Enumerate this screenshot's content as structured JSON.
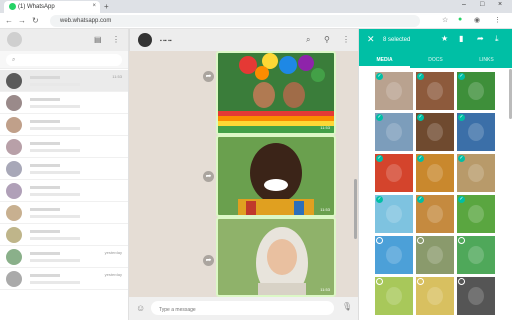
{
  "browser": {
    "tab_title": "(1) WhatsApp",
    "tab_close": "×",
    "new_tab": "+",
    "url": "web.whatsapp.com",
    "window_controls": [
      "–",
      "□",
      "×"
    ]
  },
  "left": {
    "chats": [
      {
        "time": "11:53",
        "avatar": "#5a5a5a"
      },
      {
        "time": "",
        "avatar": "#9a8a8a"
      },
      {
        "time": "",
        "avatar": "#c0a08a"
      },
      {
        "time": "",
        "avatar": "#b8a0a8"
      },
      {
        "time": "",
        "avatar": "#a8a8b8"
      },
      {
        "time": "",
        "avatar": "#b0a0b8"
      },
      {
        "time": "",
        "avatar": "#c8b090"
      },
      {
        "time": "",
        "avatar": "#bfb58a"
      },
      {
        "time": "yesterday",
        "avatar": "#8ab08a"
      },
      {
        "time": "yesterday",
        "avatar": "#aaa"
      }
    ]
  },
  "middle": {
    "photos": [
      {
        "time": "11:53"
      },
      {
        "time": "11:53"
      },
      {
        "time": "11:53"
      }
    ],
    "composer_placeholder": "Type a message"
  },
  "right": {
    "selected_count": "8 selected",
    "tabs": [
      "MEDIA",
      "DOCS",
      "LINKS"
    ],
    "active_tab": "MEDIA",
    "thumb_colors": [
      [
        "#b9a28f",
        "#8d5a3c",
        "#3e8f3a"
      ],
      [
        "#7c9dbb",
        "#6f4a2f",
        "#3b6fa8"
      ],
      [
        "#d4442c",
        "#c9882d",
        "#b89a6a"
      ],
      [
        "#7ec3e0",
        "#c58a3f",
        "#5aa640"
      ],
      [
        "#4ca0d8",
        "#8a9a6c",
        "#4fa85a"
      ],
      [
        "#a8c85a",
        "#d8c060",
        "#555"
      ]
    ],
    "selected_rows": 4
  }
}
